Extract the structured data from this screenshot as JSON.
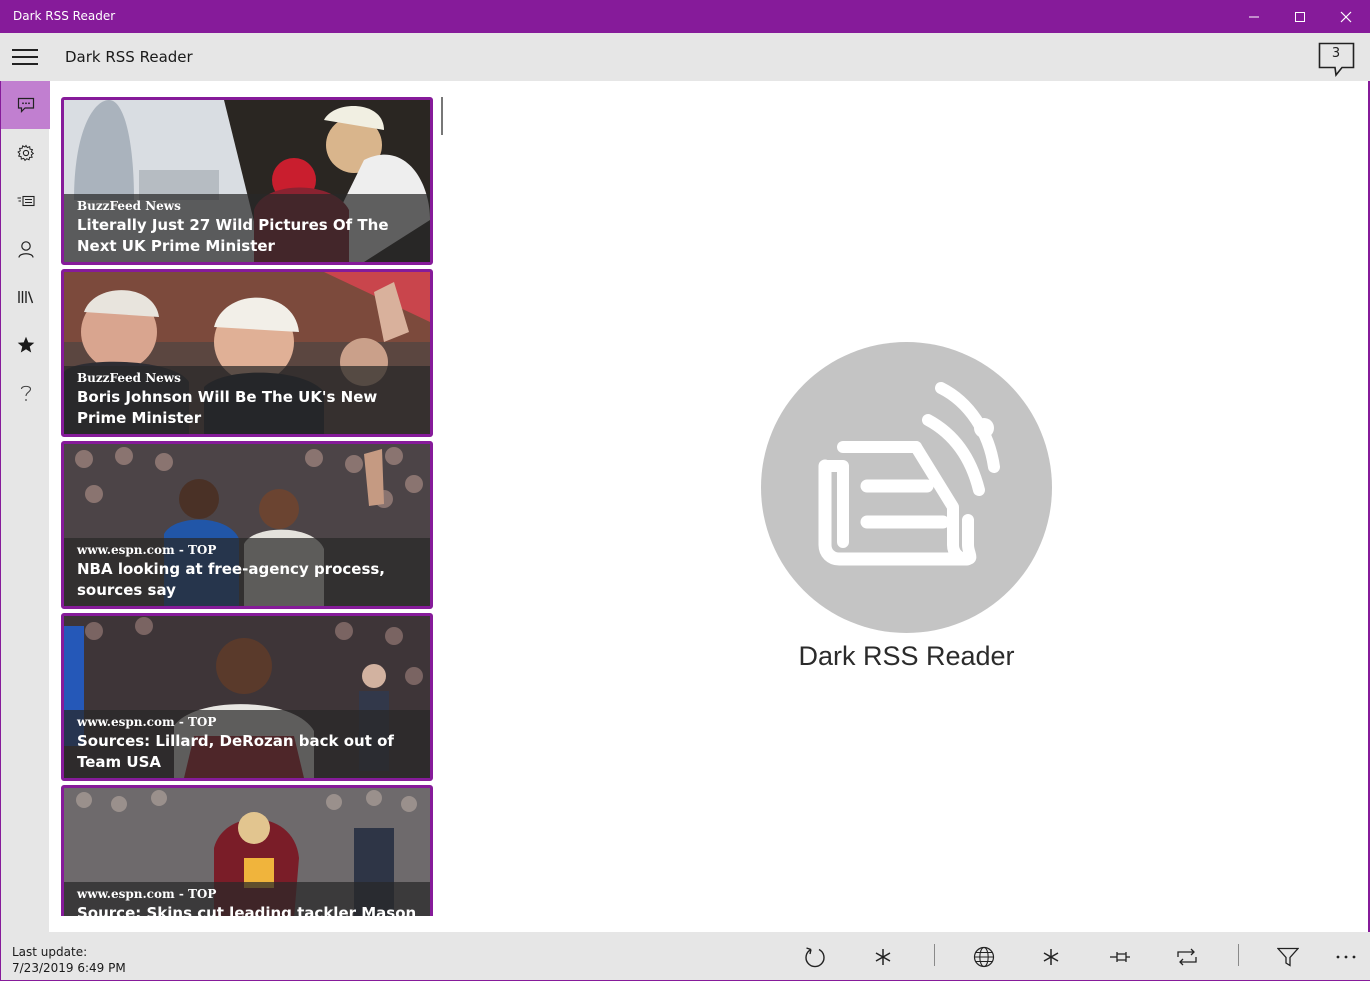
{
  "window": {
    "title": "Dark RSS Reader",
    "accent_color": "#861b9a"
  },
  "appbar": {
    "title": "Dark RSS Reader",
    "notification_count": "3"
  },
  "sidebar": {
    "items": [
      {
        "icon": "feeds-icon",
        "active": true
      },
      {
        "icon": "gear-icon",
        "active": false
      },
      {
        "icon": "news-icon",
        "active": false
      },
      {
        "icon": "person-icon",
        "active": false
      },
      {
        "icon": "library-icon",
        "active": false
      },
      {
        "icon": "star-icon",
        "active": false
      },
      {
        "icon": "help-icon",
        "active": false
      }
    ]
  },
  "feed": {
    "items": [
      {
        "source": "BuzzFeed News",
        "headline": "Literally Just 27 Wild Pictures Of The Next UK Prime Minister"
      },
      {
        "source": "BuzzFeed News",
        "headline": "Boris Johnson Will Be The UK's New Prime Minister"
      },
      {
        "source": "www.espn.com - TOP",
        "headline": "NBA looking at free-agency process, sources say"
      },
      {
        "source": "www.espn.com - TOP",
        "headline": "Sources: Lillard, DeRozan back out of Team USA"
      },
      {
        "source": "www.espn.com - TOP",
        "headline": "Source: Skins cut leading tackler Mason"
      }
    ]
  },
  "main": {
    "logo_text": "Dark RSS Reader"
  },
  "statusbar": {
    "last_update_label": "Last update:",
    "last_update_value": "7/23/2019 6:49 PM"
  },
  "toolbar": {
    "icons": [
      "refresh-icon",
      "asterisk-icon",
      "globe-icon",
      "asterisk-icon",
      "pin-icon",
      "repeat-icon",
      "filter-icon",
      "more-icon"
    ]
  }
}
